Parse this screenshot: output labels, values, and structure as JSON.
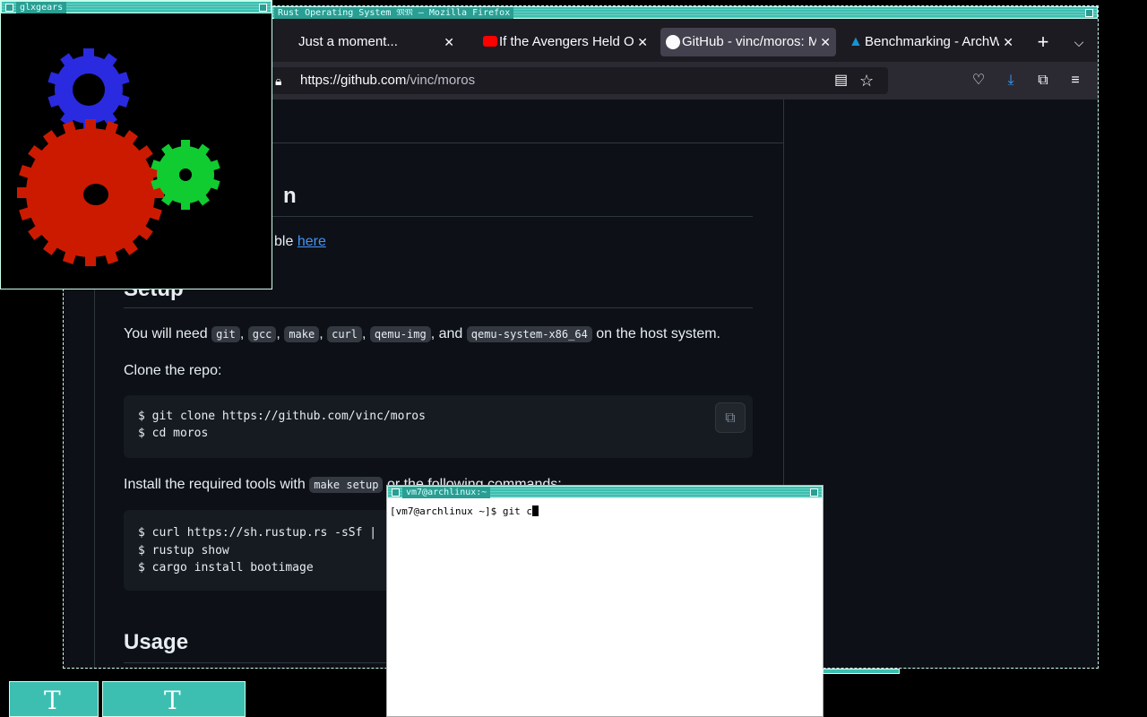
{
  "firefox": {
    "window_title": "Rust Operating System 𝔐𝔐 — Mozilla Firefox",
    "tabs": [
      {
        "label": "Just a moment...",
        "icon": "page-icon"
      },
      {
        "label": "If the Avengers Held O",
        "icon": "youtube-icon"
      },
      {
        "label": "GitHub - vinc/moros: M",
        "icon": "github-icon"
      },
      {
        "label": "Benchmarking - ArchW",
        "icon": "arch-icon"
      }
    ],
    "url_host": "https://github.com",
    "url_path": "/vinc/moros"
  },
  "readme": {
    "heading_partial": "n",
    "para_partial": "ble",
    "link_here": "here",
    "setup_heading": "Setup",
    "need_prefix": "You will need",
    "tools": [
      "git",
      "gcc",
      "make",
      "curl",
      "qemu-img"
    ],
    "and_word": ", and",
    "tool_last": "qemu-system-x86_64",
    "need_suffix": "on the host system.",
    "clone_text": "Clone the repo:",
    "clone_cmd1": "$ git clone https://github.com/vinc/moros",
    "clone_cmd2": "$ cd moros",
    "install_prefix": "Install the required tools with",
    "install_code": "make setup",
    "install_suffix": "or the following commands:",
    "install_cmd1": "$ curl https://sh.rustup.rs -sSf |",
    "install_cmd2": "$ rustup show",
    "install_cmd3": "$ cargo install bootimage",
    "usage_heading": "Usage"
  },
  "glxgears": {
    "title": "glxgears",
    "colors": {
      "blue": "#2a2ae0",
      "red": "#cc1a00",
      "green": "#10cc30"
    }
  },
  "terminal": {
    "title": "vm7@archlinux:~",
    "line": "[vm7@archlinux ~]$ git c"
  }
}
